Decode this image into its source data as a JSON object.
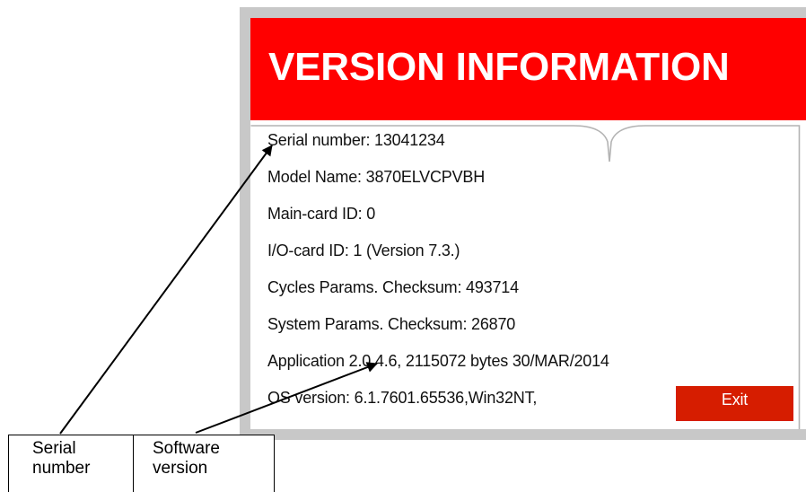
{
  "dialog": {
    "title": "VERSION INFORMATION",
    "lines": [
      "Serial number: 13041234",
      "Model Name: 3870ELVCPVBH",
      "Main-card ID: 0",
      "I/O-card ID: 1 (Version 7.3.)",
      "Cycles Params. Checksum: 493714",
      "System Params. Checksum: 26870",
      "Application 2.0.4.6, 2115072 bytes 30/MAR/2014",
      "OS version: 6.1.7601.65536,Win32NT,"
    ],
    "exit_label": "Exit"
  },
  "callouts": {
    "serial_number": "Serial\nnumber",
    "software_version": "Software\nversion"
  },
  "colors": {
    "header_red": "#ff0000",
    "exit_button": "#d61d00",
    "window_frame": "#c8c8c8",
    "content_border": "#b3b3b3"
  }
}
